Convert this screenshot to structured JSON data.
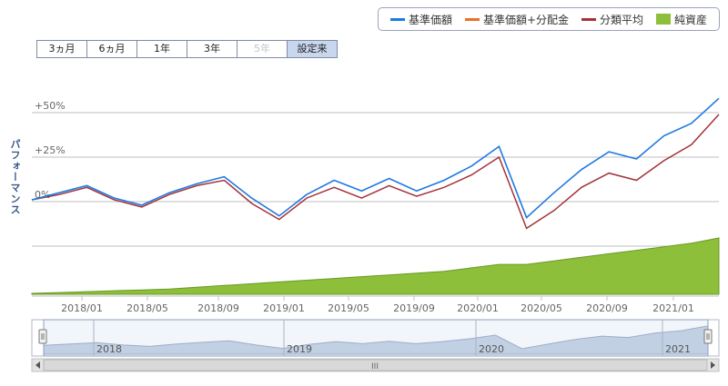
{
  "legend": [
    {
      "label": "基準価額",
      "color": "#1f7ae0",
      "kind": "line"
    },
    {
      "label": "基準価額+分配金",
      "color": "#e8722a",
      "kind": "line"
    },
    {
      "label": "分類平均",
      "color": "#a3333a",
      "kind": "line"
    },
    {
      "label": "純資産",
      "color": "#8dbf3a",
      "kind": "area"
    }
  ],
  "range_buttons": [
    {
      "label": "3ヵ月",
      "state": "normal"
    },
    {
      "label": "6ヵ月",
      "state": "normal"
    },
    {
      "label": "1年",
      "state": "normal"
    },
    {
      "label": "3年",
      "state": "normal"
    },
    {
      "label": "5年",
      "state": "disabled"
    },
    {
      "label": "設定来",
      "state": "active"
    }
  ],
  "ylabel": "パフォーマンス",
  "navigator": {
    "year_labels": [
      "2018",
      "2019",
      "2020",
      "2021"
    ],
    "scroll_grip": "III"
  },
  "chart_data": {
    "type": "line",
    "x_tick_labels": [
      "2018/01",
      "2018/05",
      "2018/09",
      "2019/01",
      "2019/05",
      "2019/09",
      "2020/01",
      "2020/05",
      "2020/09",
      "2021/01"
    ],
    "y_tick_labels": [
      "+50%",
      "+25%",
      "0%"
    ],
    "x": [
      "2017/10",
      "2017/12",
      "2018/01",
      "2018/02",
      "2018/03",
      "2018/05",
      "2018/07",
      "2018/09",
      "2018/10",
      "2018/12",
      "2019/01",
      "2019/03",
      "2019/05",
      "2019/06",
      "2019/08",
      "2019/10",
      "2019/12",
      "2020/02",
      "2020/03",
      "2020/04",
      "2020/06",
      "2020/08",
      "2020/10",
      "2020/11",
      "2021/01",
      "2021/03"
    ],
    "series": [
      {
        "name": "基準価額",
        "values": [
          1,
          5,
          9,
          2,
          -2,
          5,
          10,
          14,
          2,
          -8,
          4,
          12,
          6,
          13,
          6,
          12,
          20,
          31,
          -9,
          5,
          18,
          28,
          24,
          37,
          44,
          58
        ]
      },
      {
        "name": "分類平均",
        "values": [
          1,
          4,
          8,
          1,
          -3,
          4,
          9,
          12,
          -1,
          -10,
          2,
          8,
          2,
          9,
          3,
          8,
          15,
          25,
          -15,
          -5,
          8,
          16,
          12,
          23,
          32,
          49
        ]
      },
      {
        "name": "純資産",
        "values": [
          0.5,
          1,
          1.5,
          2,
          2.5,
          3,
          4,
          5,
          6,
          7,
          8,
          9,
          10,
          11,
          12,
          13,
          15,
          17,
          17,
          19,
          21,
          23,
          25,
          27,
          29,
          32
        ]
      }
    ],
    "ylim": [
      -25,
      62
    ],
    "grid": true,
    "legend_position": "top-right"
  }
}
